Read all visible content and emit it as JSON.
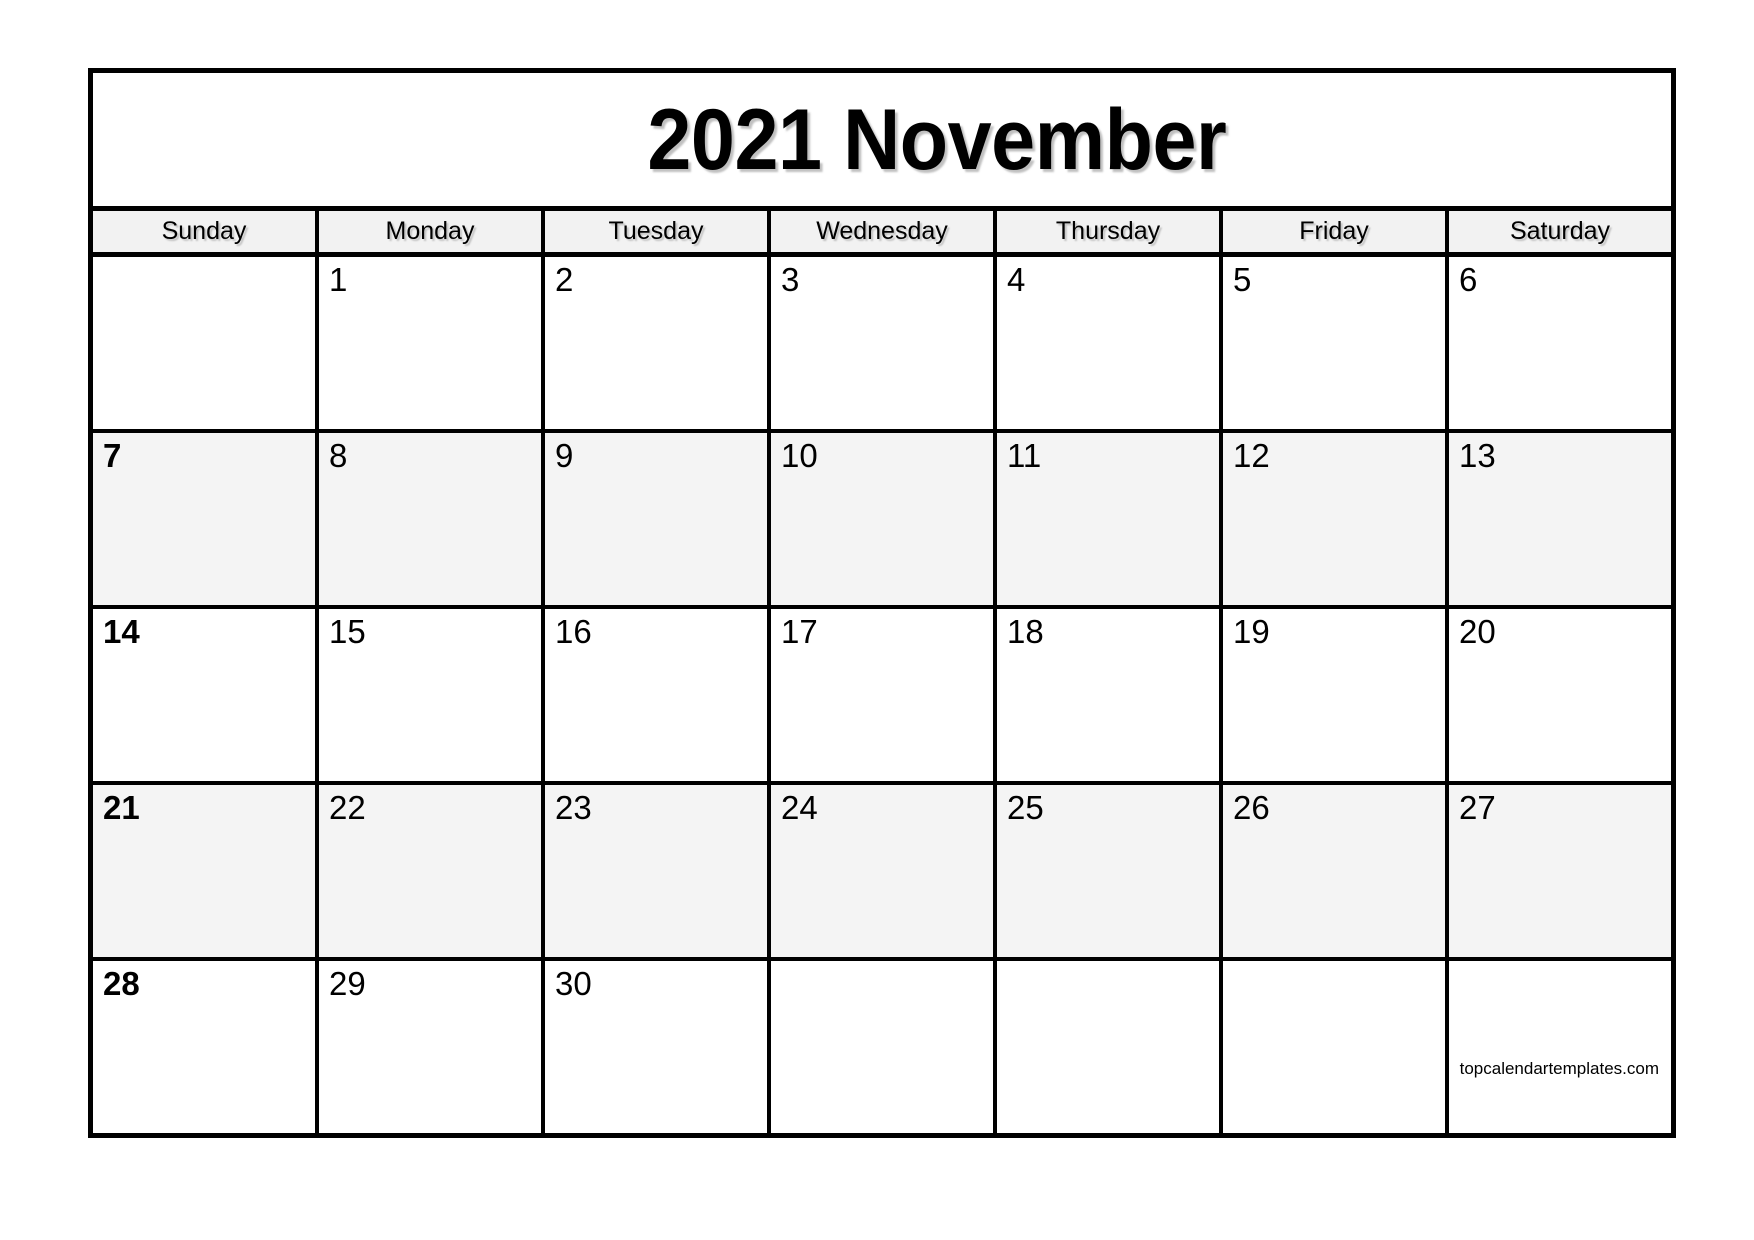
{
  "calendar": {
    "title": "2021 November",
    "year": "2021",
    "month": "November",
    "weekday_headers": [
      "Sunday",
      "Monday",
      "Tuesday",
      "Wednesday",
      "Thursday",
      "Friday",
      "Saturday"
    ],
    "weeks": [
      {
        "shaded": false,
        "days": [
          {
            "num": "",
            "empty": true
          },
          {
            "num": "1",
            "empty": false
          },
          {
            "num": "2",
            "empty": false
          },
          {
            "num": "3",
            "empty": false
          },
          {
            "num": "4",
            "empty": false
          },
          {
            "num": "5",
            "empty": false
          },
          {
            "num": "6",
            "empty": false
          }
        ]
      },
      {
        "shaded": true,
        "days": [
          {
            "num": "7",
            "empty": false
          },
          {
            "num": "8",
            "empty": false
          },
          {
            "num": "9",
            "empty": false
          },
          {
            "num": "10",
            "empty": false
          },
          {
            "num": "11",
            "empty": false
          },
          {
            "num": "12",
            "empty": false
          },
          {
            "num": "13",
            "empty": false
          }
        ]
      },
      {
        "shaded": false,
        "days": [
          {
            "num": "14",
            "empty": false
          },
          {
            "num": "15",
            "empty": false
          },
          {
            "num": "16",
            "empty": false
          },
          {
            "num": "17",
            "empty": false
          },
          {
            "num": "18",
            "empty": false
          },
          {
            "num": "19",
            "empty": false
          },
          {
            "num": "20",
            "empty": false
          }
        ]
      },
      {
        "shaded": true,
        "days": [
          {
            "num": "21",
            "empty": false
          },
          {
            "num": "22",
            "empty": false
          },
          {
            "num": "23",
            "empty": false
          },
          {
            "num": "24",
            "empty": false
          },
          {
            "num": "25",
            "empty": false
          },
          {
            "num": "26",
            "empty": false
          },
          {
            "num": "27",
            "empty": false
          }
        ]
      },
      {
        "shaded": false,
        "days": [
          {
            "num": "28",
            "empty": false
          },
          {
            "num": "29",
            "empty": false
          },
          {
            "num": "30",
            "empty": false
          },
          {
            "num": "",
            "empty": true
          },
          {
            "num": "",
            "empty": true
          },
          {
            "num": "",
            "empty": true
          },
          {
            "num": "",
            "empty": true
          }
        ]
      }
    ],
    "watermark": "topcalendartemplates.com",
    "colors": {
      "border": "#000000",
      "header_background": "#f2f2f2",
      "shaded_row_background": "#f4f4f4",
      "cell_background": "#ffffff",
      "text": "#000000"
    }
  }
}
